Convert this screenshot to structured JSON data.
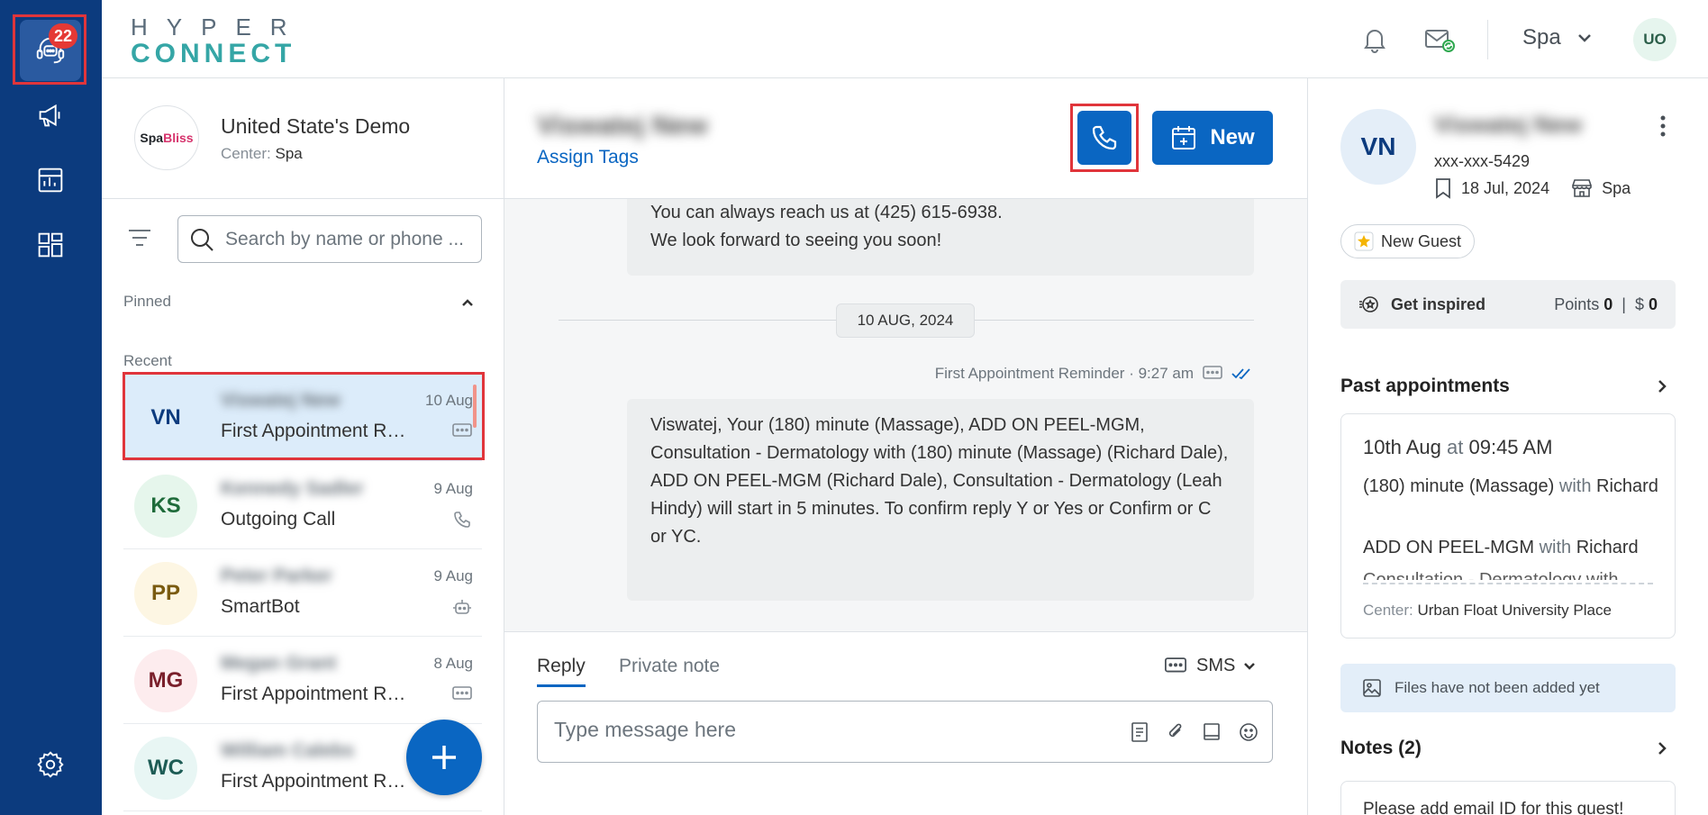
{
  "rail": {
    "badge_count": "22",
    "items": [
      "support-agent-icon",
      "megaphone-icon",
      "reports-icon",
      "apps-grid-icon"
    ],
    "settings": "settings-icon"
  },
  "topbar": {
    "logo_top": "HYPER",
    "logo_bottom": "CONNECT",
    "center_select": "Spa",
    "user_initials": "UO"
  },
  "account": {
    "logo_text_1": "Spa",
    "logo_text_2": "Bliss",
    "name": "United State's Demo",
    "center_label": "Center:",
    "center_value": "Spa"
  },
  "search": {
    "placeholder": "Search by name or phone ..."
  },
  "sections": {
    "pinned": "Pinned",
    "recent": "Recent"
  },
  "conversations": [
    {
      "initials": "VN",
      "name": "Viswatej New",
      "preview": "First Appointment Reminder",
      "date": "10 Aug",
      "icon": "sms-icon",
      "bg": "#dcecfa",
      "fg": "#0c3b7e"
    },
    {
      "initials": "KS",
      "name": "Kennedy Sadler",
      "preview": "Outgoing Call",
      "date": "9 Aug",
      "icon": "phone-icon",
      "bg": "#e6f6ec",
      "fg": "#1e6b3a"
    },
    {
      "initials": "PP",
      "name": "Peter Parker",
      "preview": "SmartBot",
      "date": "9 Aug",
      "icon": "bot-icon",
      "bg": "#fdf6e3",
      "fg": "#7a5b10"
    },
    {
      "initials": "MG",
      "name": "Megan Grant",
      "preview": "First Appointment Reminder",
      "date": "8 Aug",
      "icon": "sms-icon",
      "bg": "#fdecee",
      "fg": "#7a1f2b"
    },
    {
      "initials": "WC",
      "name": "William Calebs",
      "preview": "First Appointment Reminder",
      "date": "8 Aug",
      "icon": "sms-icon",
      "bg": "#e8f6f4",
      "fg": "#1d5c55"
    }
  ],
  "chat": {
    "contact_name": "Viswatej New",
    "assign_tags": "Assign Tags",
    "new_label": "New",
    "prev_message_line1": "You can always reach us at (425) 615-6938.",
    "prev_message_line2": "We look forward to seeing you soon!",
    "date_chip": "10 AUG, 2024",
    "msg_meta": "First Appointment Reminder · 9:27 am",
    "message": "Viswatej, Your (180) minute (Massage), ADD ON PEEL-MGM, Consultation - Dermatology with (180) minute (Massage) (Richard Dale), ADD ON PEEL-MGM (Richard Dale), Consultation - Dermatology (Leah  Hindy) will start in 5 minutes. To confirm reply Y or Yes or Confirm or C or YC."
  },
  "composer": {
    "tab_reply": "Reply",
    "tab_note": "Private note",
    "channel": "SMS",
    "placeholder": "Type message here"
  },
  "guest": {
    "initials": "VN",
    "name": "Viswatej New",
    "phone": "xxx-xxx-5429",
    "date": "18 Jul, 2024",
    "center": "Spa",
    "tag": "New Guest",
    "inspire_label": "Get inspired",
    "points_label": "Points",
    "points_value": "0",
    "dollar_label": "$",
    "dollar_value": "0",
    "past_appointments_title": "Past appointments",
    "appointment": {
      "date": "10th Aug",
      "at": "at",
      "time": "09:45 AM",
      "service1": "(180) minute (Massage)",
      "service1_with": "with",
      "service1_staff": "Richard",
      "service2": "ADD ON PEEL-MGM",
      "service2_with": "with",
      "service2_staff": "Richard",
      "service3": "Consultation - Dermatology with",
      "center_label": "Center:",
      "center_value": "Urban Float University Place"
    },
    "files_text": "Files have not been added yet",
    "notes_title": "Notes (2)",
    "note_text": "Please add email ID for this guest!"
  }
}
